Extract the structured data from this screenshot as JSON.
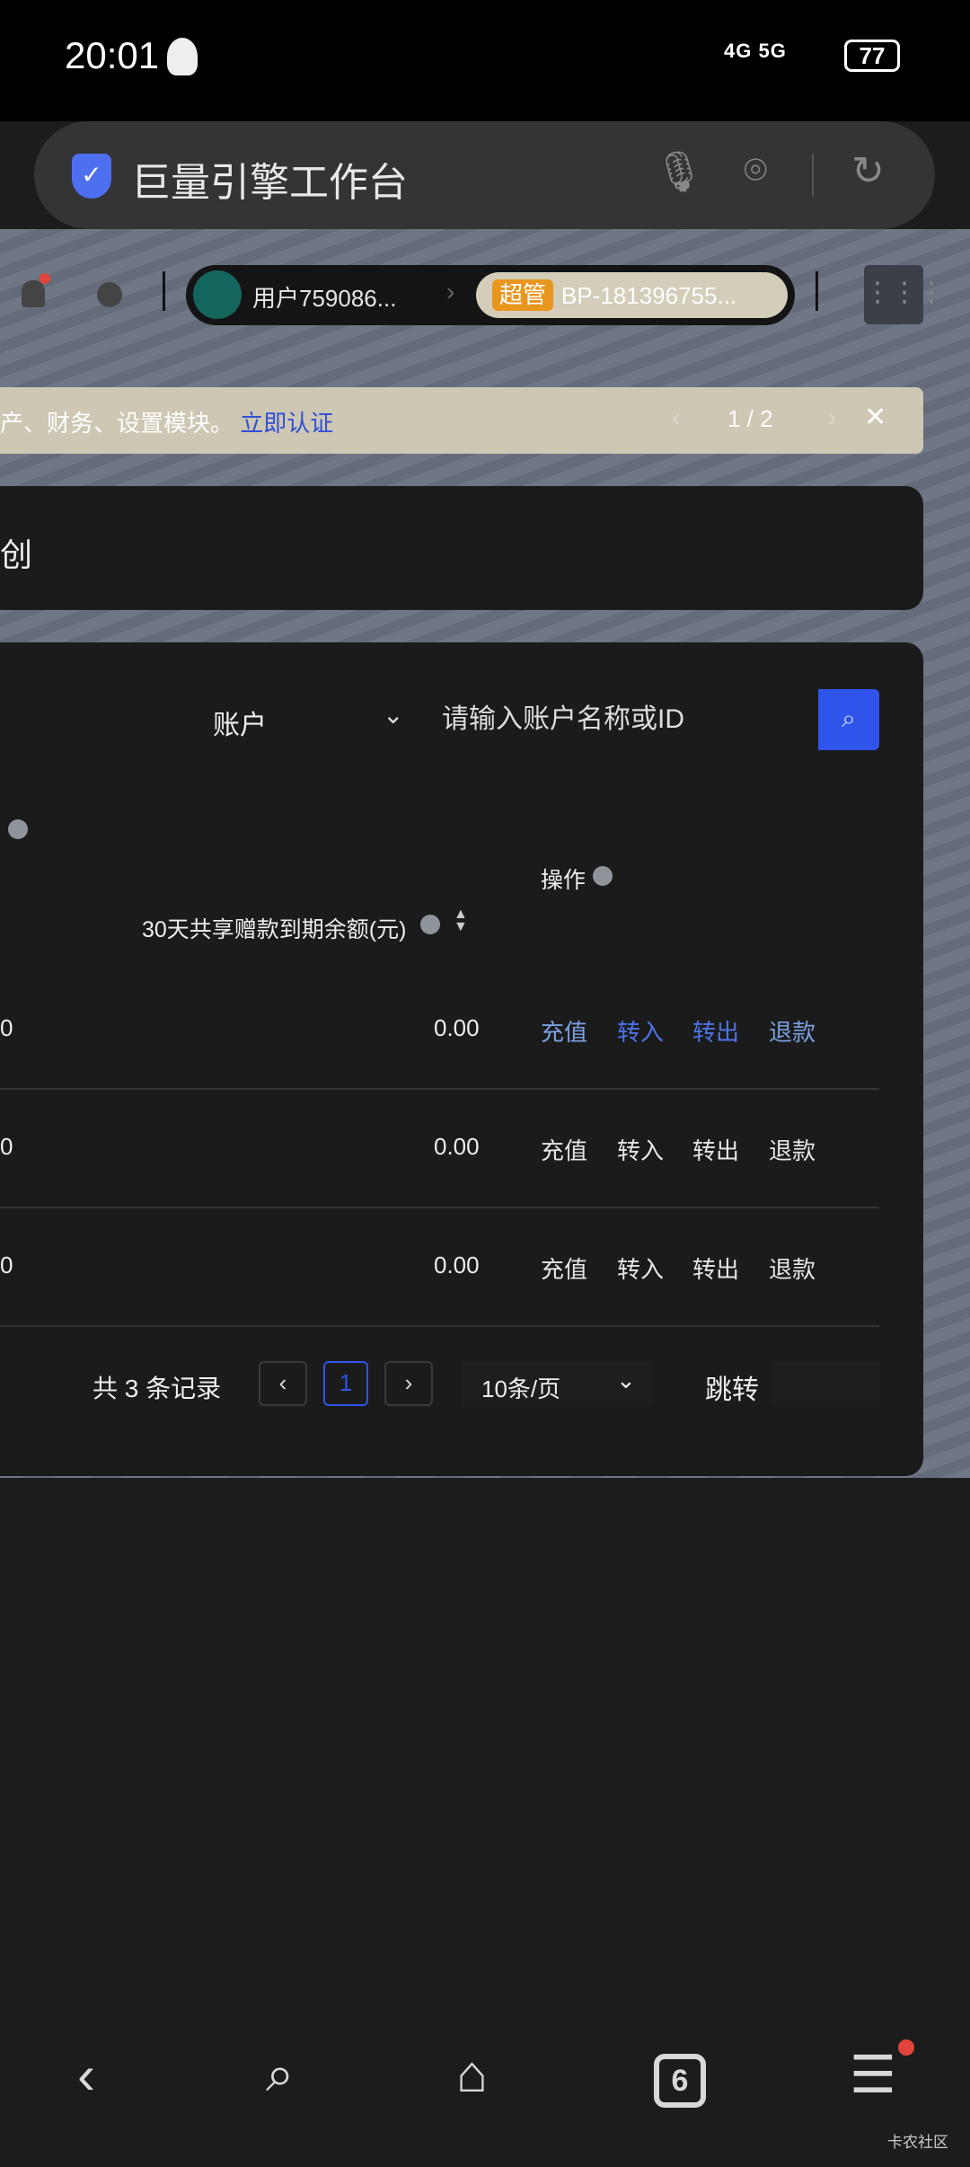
{
  "status_bar": {
    "time": "20:01",
    "network": "4G 5G",
    "battery": "77"
  },
  "browser": {
    "title": "巨量引擎工作台",
    "icons": [
      "shield-check-icon",
      "mic-icon",
      "camera-icon",
      "refresh-icon"
    ]
  },
  "toolbar": {
    "user": "用户759086...",
    "badge": "超管",
    "account": "BP-181396755..."
  },
  "banner": {
    "text": "产、财务、设置模块。",
    "link": "立即认证",
    "pager": "1 / 2",
    "close": "✕"
  },
  "card1": {
    "text": "创"
  },
  "filter": {
    "select_value": "账户",
    "search_placeholder": "请输入账户名称或ID"
  },
  "table": {
    "headers": {
      "expiring": "30天共享赠款到期余额(元)",
      "actions": "操作"
    },
    "rows": [
      {
        "col0": "0",
        "expiring": "0.00",
        "actions": [
          "充值",
          "转入",
          "转出",
          "退款"
        ]
      },
      {
        "col0": "0",
        "expiring": "0.00",
        "actions": [
          "充值",
          "转入",
          "转出",
          "退款"
        ]
      },
      {
        "col0": "0",
        "expiring": "0.00",
        "actions": [
          "充值",
          "转入",
          "转出",
          "退款"
        ]
      }
    ]
  },
  "pagination": {
    "total": "共 3 条记录",
    "current": "1",
    "page_size": "10条/页",
    "jump": "跳转"
  },
  "bottom_nav": {
    "tabs_count": "6",
    "watermark": "卡农社区"
  },
  "colors": {
    "accent": "#2f54eb",
    "link": "#2f4fd6",
    "badge": "#e8961e",
    "banner": "#cdc7b4"
  }
}
